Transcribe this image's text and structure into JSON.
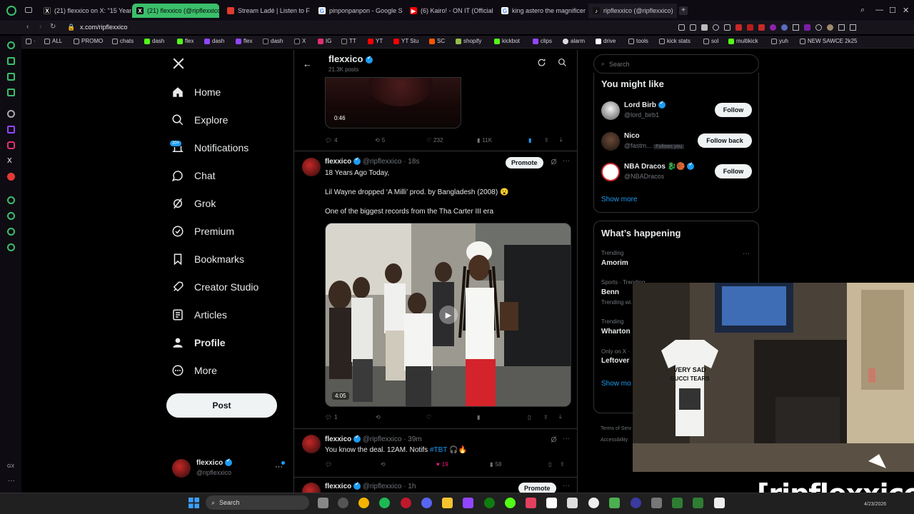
{
  "browser": {
    "tabs": [
      {
        "title": "(21) flexxico on X: \"15 Year",
        "favicon": "x"
      },
      {
        "title": "(21) flexxico (@ripflexxico",
        "favicon": "x",
        "active": true
      },
      {
        "title": "Stream Ladé | Listen to Fl",
        "favicon": "soundcloud"
      },
      {
        "title": "pinponpanpon - Google S",
        "favicon": "google"
      },
      {
        "title": "(6) Kairo! - ON IT (Official",
        "favicon": "youtube"
      },
      {
        "title": "king astero the magnificer",
        "favicon": "google"
      },
      {
        "title": "ripflexxico (@ripflexxico)",
        "favicon": "tiktok"
      }
    ],
    "url": "x.com/ripflexxico",
    "bookmarks": [
      "ALL",
      "PROMO",
      "chats",
      "dash",
      "flex",
      "dash",
      "flex",
      "dash",
      "X",
      "IG",
      "TT",
      "YT",
      "YT Stu",
      "SC",
      "shopify",
      "kickbot",
      "clips",
      "alarm",
      "drive",
      "tools",
      "kick stats",
      "sol",
      "multikick",
      "yuh",
      "NEW SAWCE 2k25"
    ]
  },
  "nav": {
    "items": [
      {
        "label": "Home",
        "icon": "home-icon"
      },
      {
        "label": "Explore",
        "icon": "search-icon"
      },
      {
        "label": "Notifications",
        "icon": "bell-icon"
      },
      {
        "label": "Chat",
        "icon": "chat-icon"
      },
      {
        "label": "Grok",
        "icon": "grok-icon"
      },
      {
        "label": "Premium",
        "icon": "premium-icon"
      },
      {
        "label": "Bookmarks",
        "icon": "bookmark-icon"
      },
      {
        "label": "Creator Studio",
        "icon": "rocket-icon"
      },
      {
        "label": "Articles",
        "icon": "article-icon"
      },
      {
        "label": "Profile",
        "icon": "person-icon"
      },
      {
        "label": "More",
        "icon": "more-icon"
      }
    ],
    "notif_badge": "20+",
    "post_label": "Post",
    "account": {
      "name": "flexxico",
      "handle": "@ripflexxico"
    }
  },
  "profile_header": {
    "name": "flexxico",
    "posts": "21.3K posts"
  },
  "tweets": [
    {
      "video_time": "0:46",
      "replies": "4",
      "reposts": "5",
      "likes": "232",
      "views": "11K"
    },
    {
      "name": "flexxico",
      "handle": "@ripflexxico",
      "time": "· 18s",
      "promote": "Promote",
      "line1": "18 Years Ago Today,",
      "line2": "Lil Wayne dropped ‘A Milli’ prod. by Bangladesh (2008) 😮",
      "line3": "One of the biggest records from the Tha Carter III era",
      "video_time": "4:05",
      "replies": "1"
    },
    {
      "name": "flexxico",
      "handle": "@ripflexxico",
      "time": "· 39m",
      "text": "You know the deal. 12AM. Notifs",
      "hashtag": "#TBT",
      "emoji": "🎧🔥",
      "likes": "19",
      "views": "58"
    },
    {
      "name": "flexxico",
      "handle": "@ripflexxico",
      "time": "· 1h",
      "promote": "Promote"
    }
  ],
  "right": {
    "search_placeholder": "Search",
    "might_like_title": "You might like",
    "suggestions": [
      {
        "name": "Lord Birb",
        "handle": "@lord_birb1",
        "button": "Follow"
      },
      {
        "name": "Nico",
        "handle": "@fastm...",
        "follows_you": "Follows you",
        "button": "Follow back"
      },
      {
        "name": "NBA Dracos 🐉🏀",
        "handle": "@NBADracos",
        "button": "Follow"
      }
    ],
    "show_more": "Show more",
    "happening_title": "What’s happening",
    "trends": [
      {
        "context": "Trending",
        "name": "Amorim"
      },
      {
        "context": "Sports · Trending",
        "name": "Benn",
        "sub": "Trending wi..."
      },
      {
        "context": "Trending",
        "name": "Wharton"
      },
      {
        "context": "Only on X ·",
        "name": "Leftover"
      }
    ],
    "show_more2": "Show mo",
    "footer1": "Terms of Serv",
    "footer2": "Accessibility"
  },
  "webcam": {
    "shirt_text": "VERY SAD\nGUCCI TEARS"
  },
  "stream_tag": "[ripflexxico]",
  "taskbar": {
    "search": "Search",
    "date": "4/23/2026"
  }
}
